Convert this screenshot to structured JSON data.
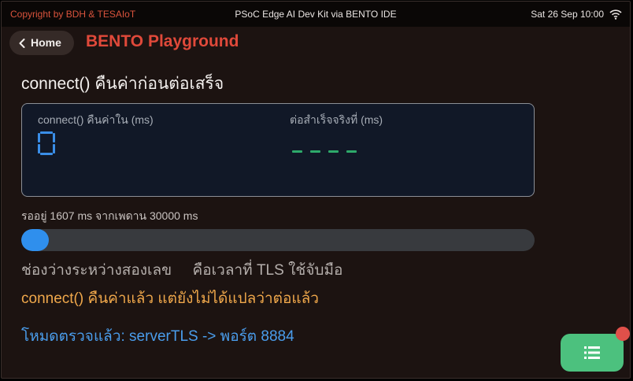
{
  "topbar": {
    "copyright": "Copyright by BDH & TESAIoT",
    "device": "PSoC Edge AI Dev Kit via BENTO IDE",
    "datetime": "Sat 26 Sep 10:00",
    "wifi_icon": "wifi-icon"
  },
  "nav": {
    "home_label": "Home",
    "app_title": "BENTO Playground"
  },
  "main": {
    "heading": "connect() คืนค่าก่อนต่อเสร็จ",
    "card": {
      "left_label": "connect() คืนค่าใน (ms)",
      "left_value": "0",
      "right_label": "ต่อสำเร็จจริงที่ (ms)",
      "right_value": "----"
    },
    "wait_text": "รออยู่ 1607 ms จากเพดาน 30000 ms",
    "progress": {
      "value_ms": 1607,
      "max_ms": 30000,
      "color": "#2f8fed"
    },
    "note_gap": "ช่องว่างระหว่างสองเลข     คือเวลาที่ TLS ใช้จับมือ",
    "note_status": "connect() คืนค่าแล้ว แต่ยังไม่ได้แปลว่าต่อแล้ว",
    "mode_line": "โหมดตรวจแล้ว: serverTLS -> พอร์ต 8884"
  },
  "fab": {
    "icon": "list-icon",
    "badge_color": "#e0504a"
  },
  "colors": {
    "accent_red": "#e0493a",
    "accent_orange": "#f0a84b",
    "accent_blue": "#4a9dec",
    "accent_green": "#4cc17e",
    "background": "#1c1311"
  }
}
